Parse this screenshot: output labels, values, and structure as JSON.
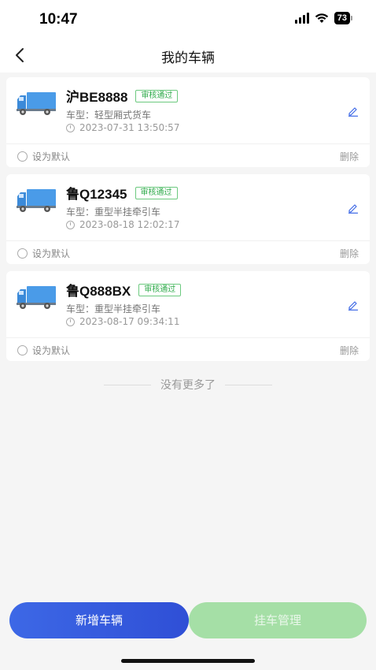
{
  "status_bar": {
    "time": "10:47",
    "battery": "73"
  },
  "nav": {
    "title": "我的车辆"
  },
  "vehicles": [
    {
      "plate": "沪BE8888",
      "badge": "审核通过",
      "type": "车型：轻型厢式货车",
      "time": "2023-07-31 13:50:57",
      "default_label": "设为默认",
      "delete_label": "删除"
    },
    {
      "plate": "鲁Q12345",
      "badge": "审核通过",
      "type": "车型：重型半挂牵引车",
      "time": "2023-08-18 12:02:17",
      "default_label": "设为默认",
      "delete_label": "删除"
    },
    {
      "plate": "鲁Q888BX",
      "badge": "审核通过",
      "type": "车型：重型半挂牵引车",
      "time": "2023-08-17 09:34:11",
      "default_label": "设为默认",
      "delete_label": "删除"
    }
  ],
  "footer_text": "没有更多了",
  "buttons": {
    "add": "新增车辆",
    "trailer": "挂车管理"
  },
  "colors": {
    "primary": "#3d68e6",
    "secondary": "#a5dfa6",
    "badge": "#2eaa4a"
  }
}
